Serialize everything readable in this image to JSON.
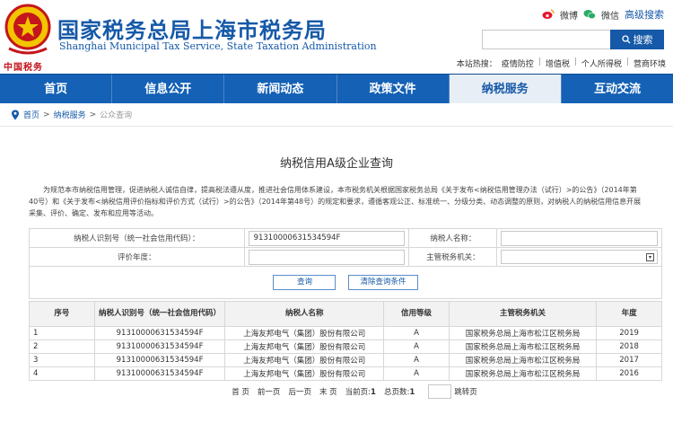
{
  "header": {
    "title": "国家税务总局上海市税务局",
    "subtitle": "Shanghai Municipal Tax Service, State Taxation Administration",
    "emblem_text": "中国税务",
    "weibo_label": "微博",
    "wechat_label": "微信",
    "advanced_search": "高级搜索",
    "search_placeholder": "",
    "search_button": "搜索",
    "quick_links_label": "本站热搜：",
    "quick_links": [
      "疫情防控",
      "增值税",
      "个人所得税",
      "营商环境"
    ]
  },
  "nav": {
    "items": [
      "首页",
      "信息公开",
      "新闻动态",
      "政策文件",
      "纳税服务",
      "互动交流"
    ],
    "active_index": 4
  },
  "breadcrumb": {
    "home": "首页",
    "level1": "纳税服务",
    "current": "公众查询"
  },
  "page": {
    "title": "纳税信用A级企业查询",
    "intro": "为规范本市纳税信用管理，促进纳税人诚信自律，提高税法遵从度，推进社会信用体系建设，本市税务机关根据国家税务总局《关于发布<纳税信用管理办法（试行）>的公告》（2014年第40号）和《关于发布<纳税信用评价指标和评价方式（试行）>的公告》（2014年第48号）的规定和要求，遵循客观公正、标准统一、分级分类、动态调整的原则，对纳税人的纳税信用信息开展采集、评价、确定、发布和应用等活动。"
  },
  "form": {
    "taxpayer_id_label": "纳税人识别号（统一社会信用代码）：",
    "taxpayer_id_value": "91310000631534594F",
    "taxpayer_name_label": "纳税人名称：",
    "taxpayer_name_value": "",
    "year_label": "评价年度：",
    "year_value": "",
    "authority_label": "主管税务机关：",
    "authority_value": "",
    "query_button": "查询",
    "clear_button": "清除查询条件"
  },
  "results": {
    "headers": [
      "序号",
      "纳税人识别号（统一社会信用代码）",
      "纳税人名称",
      "信用等级",
      "主管税务机关",
      "年度"
    ],
    "rows": [
      [
        "1",
        "91310000631534594F",
        "上海友邦电气（集团）股份有限公司",
        "A",
        "国家税务总局上海市松江区税务局",
        "2019"
      ],
      [
        "2",
        "91310000631534594F",
        "上海友邦电气（集团）股份有限公司",
        "A",
        "国家税务总局上海市松江区税务局",
        "2018"
      ],
      [
        "3",
        "91310000631534594F",
        "上海友邦电气（集团）股份有限公司",
        "A",
        "国家税务总局上海市松江区税务局",
        "2017"
      ],
      [
        "4",
        "91310000631534594F",
        "上海友邦电气（集团）股份有限公司",
        "A",
        "国家税务总局上海市松江区税务局",
        "2016"
      ]
    ]
  },
  "pager": {
    "first": "首 页",
    "prev": "前一页",
    "next": "后一页",
    "last": "末 页",
    "current_label": "当前页:",
    "current_value": "1",
    "total_label": "总页数:",
    "total_value": "1",
    "jump": "跳转页"
  },
  "colors": {
    "brand_blue": "#1559a8",
    "nav_blue": "#1461b5",
    "emblem_red": "#c4161c"
  }
}
